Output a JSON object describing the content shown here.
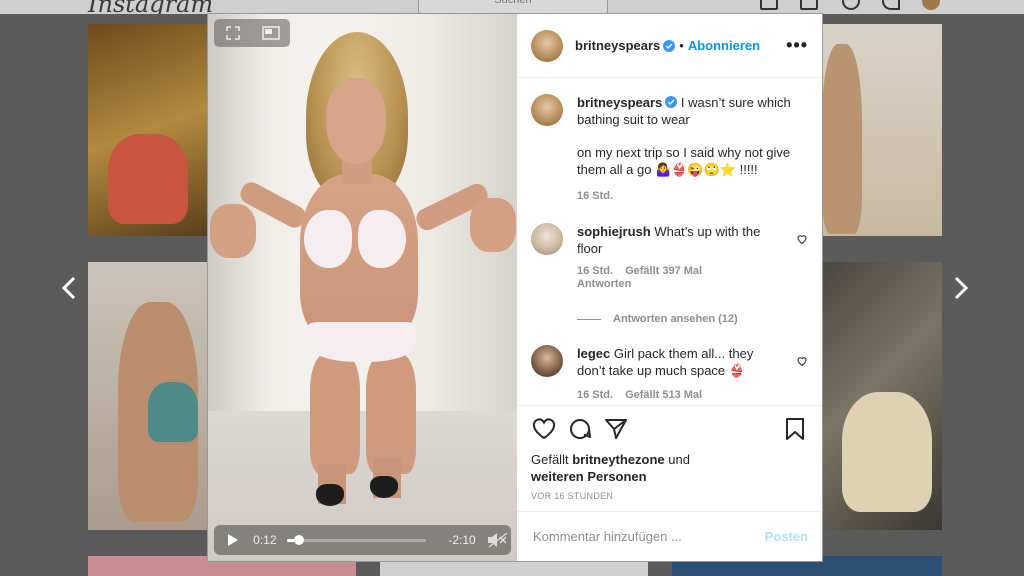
{
  "background": {
    "logo": "Instagram",
    "search_placeholder": "Suchen",
    "nav_icons": [
      "home-icon",
      "direct-icon",
      "explore-icon",
      "activity-icon",
      "profile-avatar"
    ]
  },
  "nav": {
    "prev_icon": "chevron-left-icon",
    "next_icon": "chevron-right-icon"
  },
  "video": {
    "current_time": "0:12",
    "remaining_time": "-2:10",
    "progress": 0.09,
    "muted": true
  },
  "post": {
    "username": "britneyspears",
    "follow_label": "Abonnieren",
    "dot": "•",
    "more_label": "•••",
    "caption_line1": "I wasn’t sure which bathing suit to wear",
    "caption_line2": "on my next trip so I said why not give them all a go 🤷‍♀️👙😜🙄⭐️ !!!!!",
    "caption_time": "16 Std."
  },
  "comments": [
    {
      "username": "sophiejrush",
      "text": "What’s up with the floor",
      "time": "16 Std.",
      "likes": "Gefällt 397 Mal",
      "reply": "Antworten",
      "view_replies": "Antworten ansehen (12)"
    },
    {
      "username": "legec",
      "text": "Girl pack them all... they don’t take up much space 👙",
      "time": "16 Std.",
      "likes": "Gefällt 513 Mal"
    }
  ],
  "footer": {
    "liked_prefix": "Gefällt",
    "liked_user": "britneythezone",
    "liked_and": "und",
    "liked_others": "weiteren Personen",
    "timestamp": "VOR 16 STUNDEN",
    "comment_placeholder": "Kommentar hinzufügen ...",
    "post_label": "Posten"
  },
  "colors": {
    "accent": "#0095f6",
    "post_disabled": "#b2dffc",
    "verified": "#3897f0"
  }
}
